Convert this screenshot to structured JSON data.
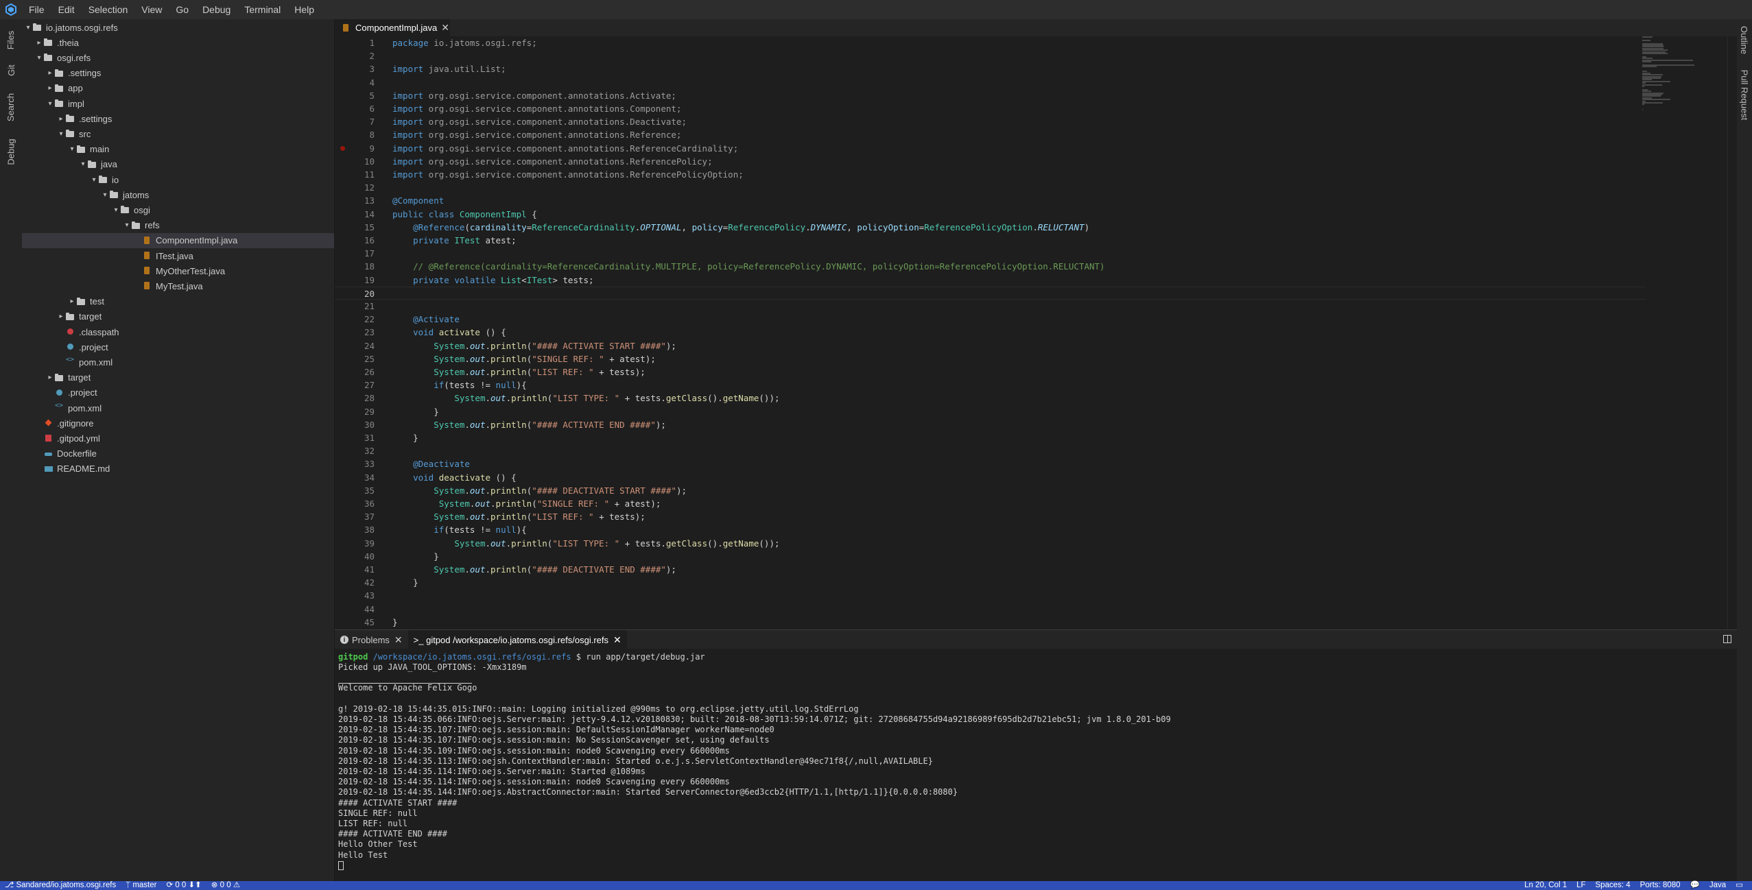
{
  "menubar": {
    "items": [
      "File",
      "Edit",
      "Selection",
      "View",
      "Go",
      "Debug",
      "Terminal",
      "Help"
    ]
  },
  "left_tabs": [
    "Files",
    "Git",
    "Search",
    "Debug"
  ],
  "right_tabs": [
    "Outline",
    "Pull Request"
  ],
  "explorer": {
    "items": [
      {
        "label": "io.jatoms.osgi.refs",
        "depth": 0,
        "kind": "folder",
        "open": true
      },
      {
        "label": ".theia",
        "depth": 1,
        "kind": "folder",
        "open": false
      },
      {
        "label": "osgi.refs",
        "depth": 1,
        "kind": "folder",
        "open": true
      },
      {
        "label": ".settings",
        "depth": 2,
        "kind": "folder",
        "open": false
      },
      {
        "label": "app",
        "depth": 2,
        "kind": "folder",
        "open": false
      },
      {
        "label": "impl",
        "depth": 2,
        "kind": "folder",
        "open": true
      },
      {
        "label": ".settings",
        "depth": 3,
        "kind": "folder",
        "open": false
      },
      {
        "label": "src",
        "depth": 3,
        "kind": "folder",
        "open": true
      },
      {
        "label": "main",
        "depth": 4,
        "kind": "folder",
        "open": true
      },
      {
        "label": "java",
        "depth": 5,
        "kind": "folder",
        "open": true
      },
      {
        "label": "io",
        "depth": 6,
        "kind": "folder",
        "open": true
      },
      {
        "label": "jatoms",
        "depth": 7,
        "kind": "folder",
        "open": true
      },
      {
        "label": "osgi",
        "depth": 8,
        "kind": "folder",
        "open": true
      },
      {
        "label": "refs",
        "depth": 9,
        "kind": "folder",
        "open": true
      },
      {
        "label": "ComponentImpl.java",
        "depth": 10,
        "kind": "jfile",
        "selected": true
      },
      {
        "label": "ITest.java",
        "depth": 10,
        "kind": "jfile"
      },
      {
        "label": "MyOtherTest.java",
        "depth": 10,
        "kind": "jfile"
      },
      {
        "label": "MyTest.java",
        "depth": 10,
        "kind": "jfile"
      },
      {
        "label": "test",
        "depth": 4,
        "kind": "folder",
        "open": false
      },
      {
        "label": "target",
        "depth": 3,
        "kind": "folder",
        "open": false
      },
      {
        "label": ".classpath",
        "depth": 3,
        "kind": "cp"
      },
      {
        "label": ".project",
        "depth": 3,
        "kind": "proj"
      },
      {
        "label": "pom.xml",
        "depth": 3,
        "kind": "xml"
      },
      {
        "label": "target",
        "depth": 2,
        "kind": "folder",
        "open": false
      },
      {
        "label": ".project",
        "depth": 2,
        "kind": "proj"
      },
      {
        "label": "pom.xml",
        "depth": 2,
        "kind": "xml"
      },
      {
        "label": ".gitignore",
        "depth": 1,
        "kind": "git"
      },
      {
        "label": ".gitpod.yml",
        "depth": 1,
        "kind": "yml"
      },
      {
        "label": "Dockerfile",
        "depth": 1,
        "kind": "docker"
      },
      {
        "label": "README.md",
        "depth": 1,
        "kind": "md"
      }
    ]
  },
  "editor": {
    "tab_label": "ComponentImpl.java",
    "current_line": 20,
    "breakpoint_line": 9,
    "lines": [
      [
        [
          "kw",
          "package"
        ],
        [
          "dim",
          " io.jatoms.osgi.refs;"
        ]
      ],
      [],
      [
        [
          "kw",
          "import"
        ],
        [
          "dim",
          " java.util.List;"
        ]
      ],
      [],
      [
        [
          "kw",
          "import"
        ],
        [
          "dim",
          " org.osgi.service.component.annotations.Activate;"
        ]
      ],
      [
        [
          "kw",
          "import"
        ],
        [
          "dim",
          " org.osgi.service.component.annotations.Component;"
        ]
      ],
      [
        [
          "kw",
          "import"
        ],
        [
          "dim",
          " org.osgi.service.component.annotations.Deactivate;"
        ]
      ],
      [
        [
          "kw",
          "import"
        ],
        [
          "dim",
          " org.osgi.service.component.annotations.Reference;"
        ]
      ],
      [
        [
          "kw",
          "import"
        ],
        [
          "dim",
          " org.osgi.service.component.annotations.ReferenceCardinality;"
        ]
      ],
      [
        [
          "kw",
          "import"
        ],
        [
          "dim",
          " org.osgi.service.component.annotations.ReferencePolicy;"
        ]
      ],
      [
        [
          "kw",
          "import"
        ],
        [
          "dim",
          " org.osgi.service.component.annotations.ReferencePolicyOption;"
        ]
      ],
      [],
      [
        [
          "kw",
          "@Component"
        ]
      ],
      [
        [
          "kw",
          "public"
        ],
        [
          "t",
          " "
        ],
        [
          "kw",
          "class"
        ],
        [
          "t",
          " "
        ],
        [
          "ty",
          "ComponentImpl"
        ],
        [
          "t",
          " {"
        ]
      ],
      [
        [
          "t",
          "    "
        ],
        [
          "kw",
          "@Reference"
        ],
        [
          "t",
          "("
        ],
        [
          "fi",
          "cardinality"
        ],
        [
          "t",
          "="
        ],
        [
          "ty",
          "ReferenceCardinality"
        ],
        [
          "t",
          "."
        ],
        [
          "fo",
          "OPTIONAL"
        ],
        [
          "t",
          ", "
        ],
        [
          "fi",
          "policy"
        ],
        [
          "t",
          "="
        ],
        [
          "ty",
          "ReferencePolicy"
        ],
        [
          "t",
          "."
        ],
        [
          "fo",
          "DYNAMIC"
        ],
        [
          "t",
          ", "
        ],
        [
          "fi",
          "policyOption"
        ],
        [
          "t",
          "="
        ],
        [
          "ty",
          "ReferencePolicyOption"
        ],
        [
          "t",
          "."
        ],
        [
          "fo",
          "RELUCTANT"
        ],
        [
          "t",
          ")"
        ]
      ],
      [
        [
          "t",
          "    "
        ],
        [
          "kw",
          "private"
        ],
        [
          "t",
          " "
        ],
        [
          "ty",
          "ITest"
        ],
        [
          "t",
          " atest;"
        ]
      ],
      [],
      [
        [
          "t",
          "    "
        ],
        [
          "cm",
          "// @Reference(cardinality=ReferenceCardinality.MULTIPLE, policy=ReferencePolicy.DYNAMIC, policyOption=ReferencePolicyOption.RELUCTANT)"
        ]
      ],
      [
        [
          "t",
          "    "
        ],
        [
          "kw",
          "private"
        ],
        [
          "t",
          " "
        ],
        [
          "kw",
          "volatile"
        ],
        [
          "t",
          " "
        ],
        [
          "ty",
          "List"
        ],
        [
          "t",
          "<"
        ],
        [
          "ty",
          "ITest"
        ],
        [
          "t",
          "> tests;"
        ]
      ],
      [],
      [],
      [
        [
          "t",
          "    "
        ],
        [
          "kw",
          "@Activate"
        ]
      ],
      [
        [
          "t",
          "    "
        ],
        [
          "kw",
          "void"
        ],
        [
          "t",
          " "
        ],
        [
          "an",
          "activate"
        ],
        [
          "t",
          " () {"
        ]
      ],
      [
        [
          "t",
          "        "
        ],
        [
          "ty",
          "System"
        ],
        [
          "t",
          "."
        ],
        [
          "fo",
          "out"
        ],
        [
          "t",
          "."
        ],
        [
          "an",
          "println"
        ],
        [
          "t",
          "("
        ],
        [
          "st",
          "\"#### ACTIVATE START ####\""
        ],
        [
          "t",
          ");"
        ]
      ],
      [
        [
          "t",
          "        "
        ],
        [
          "ty",
          "System"
        ],
        [
          "t",
          "."
        ],
        [
          "fo",
          "out"
        ],
        [
          "t",
          "."
        ],
        [
          "an",
          "println"
        ],
        [
          "t",
          "("
        ],
        [
          "st",
          "\"SINGLE REF: \""
        ],
        [
          "t",
          " + atest);"
        ]
      ],
      [
        [
          "t",
          "        "
        ],
        [
          "ty",
          "System"
        ],
        [
          "t",
          "."
        ],
        [
          "fo",
          "out"
        ],
        [
          "t",
          "."
        ],
        [
          "an",
          "println"
        ],
        [
          "t",
          "("
        ],
        [
          "st",
          "\"LIST REF: \""
        ],
        [
          "t",
          " + tests);"
        ]
      ],
      [
        [
          "t",
          "        "
        ],
        [
          "kw",
          "if"
        ],
        [
          "t",
          "(tests != "
        ],
        [
          "kw",
          "null"
        ],
        [
          "t",
          "){"
        ]
      ],
      [
        [
          "t",
          "            "
        ],
        [
          "ty",
          "System"
        ],
        [
          "t",
          "."
        ],
        [
          "fo",
          "out"
        ],
        [
          "t",
          "."
        ],
        [
          "an",
          "println"
        ],
        [
          "t",
          "("
        ],
        [
          "st",
          "\"LIST TYPE: \""
        ],
        [
          "t",
          " + tests."
        ],
        [
          "an",
          "getClass"
        ],
        [
          "t",
          "()."
        ],
        [
          "an",
          "getName"
        ],
        [
          "t",
          "());"
        ]
      ],
      [
        [
          "t",
          "        }"
        ]
      ],
      [
        [
          "t",
          "        "
        ],
        [
          "ty",
          "System"
        ],
        [
          "t",
          "."
        ],
        [
          "fo",
          "out"
        ],
        [
          "t",
          "."
        ],
        [
          "an",
          "println"
        ],
        [
          "t",
          "("
        ],
        [
          "st",
          "\"#### ACTIVATE END ####\""
        ],
        [
          "t",
          ");"
        ]
      ],
      [
        [
          "t",
          "    }"
        ]
      ],
      [],
      [
        [
          "t",
          "    "
        ],
        [
          "kw",
          "@Deactivate"
        ]
      ],
      [
        [
          "t",
          "    "
        ],
        [
          "kw",
          "void"
        ],
        [
          "t",
          " "
        ],
        [
          "an",
          "deactivate"
        ],
        [
          "t",
          " () {"
        ]
      ],
      [
        [
          "t",
          "        "
        ],
        [
          "ty",
          "System"
        ],
        [
          "t",
          "."
        ],
        [
          "fo",
          "out"
        ],
        [
          "t",
          "."
        ],
        [
          "an",
          "println"
        ],
        [
          "t",
          "("
        ],
        [
          "st",
          "\"#### DEACTIVATE START ####\""
        ],
        [
          "t",
          ");"
        ]
      ],
      [
        [
          "t",
          "         "
        ],
        [
          "ty",
          "System"
        ],
        [
          "t",
          "."
        ],
        [
          "fo",
          "out"
        ],
        [
          "t",
          "."
        ],
        [
          "an",
          "println"
        ],
        [
          "t",
          "("
        ],
        [
          "st",
          "\"SINGLE REF: \""
        ],
        [
          "t",
          " + atest);"
        ]
      ],
      [
        [
          "t",
          "        "
        ],
        [
          "ty",
          "System"
        ],
        [
          "t",
          "."
        ],
        [
          "fo",
          "out"
        ],
        [
          "t",
          "."
        ],
        [
          "an",
          "println"
        ],
        [
          "t",
          "("
        ],
        [
          "st",
          "\"LIST REF: \""
        ],
        [
          "t",
          " + tests);"
        ]
      ],
      [
        [
          "t",
          "        "
        ],
        [
          "kw",
          "if"
        ],
        [
          "t",
          "(tests != "
        ],
        [
          "kw",
          "null"
        ],
        [
          "t",
          "){"
        ]
      ],
      [
        [
          "t",
          "            "
        ],
        [
          "ty",
          "System"
        ],
        [
          "t",
          "."
        ],
        [
          "fo",
          "out"
        ],
        [
          "t",
          "."
        ],
        [
          "an",
          "println"
        ],
        [
          "t",
          "("
        ],
        [
          "st",
          "\"LIST TYPE: \""
        ],
        [
          "t",
          " + tests."
        ],
        [
          "an",
          "getClass"
        ],
        [
          "t",
          "()."
        ],
        [
          "an",
          "getName"
        ],
        [
          "t",
          "());"
        ]
      ],
      [
        [
          "t",
          "        }"
        ]
      ],
      [
        [
          "t",
          "        "
        ],
        [
          "ty",
          "System"
        ],
        [
          "t",
          "."
        ],
        [
          "fo",
          "out"
        ],
        [
          "t",
          "."
        ],
        [
          "an",
          "println"
        ],
        [
          "t",
          "("
        ],
        [
          "st",
          "\"#### DEACTIVATE END ####\""
        ],
        [
          "t",
          ");"
        ]
      ],
      [
        [
          "t",
          "    }"
        ]
      ],
      [],
      [],
      [
        [
          "t",
          "}"
        ]
      ],
      []
    ]
  },
  "panel": {
    "tabs": [
      "Problems",
      ">_ gitpod /workspace/io.jatoms.osgi.refs/osgi.refs"
    ],
    "prompt_user": "gitpod",
    "prompt_path": "/workspace/io.jatoms.osgi.refs/osgi.refs",
    "prompt_cmd": " $ run app/target/debug.jar",
    "lines": [
      "Picked up JAVA_TOOL_OPTIONS: -Xmx3189m",
      "",
      "Welcome to Apache Felix Gogo",
      "",
      "g! 2019-02-18 15:44:35.015:INFO::main: Logging initialized @990ms to org.eclipse.jetty.util.log.StdErrLog",
      "2019-02-18 15:44:35.066:INFO:oejs.Server:main: jetty-9.4.12.v20180830; built: 2018-08-30T13:59:14.071Z; git: 27208684755d94a92186989f695db2d7b21ebc51; jvm 1.8.0_201-b09",
      "2019-02-18 15:44:35.107:INFO:oejs.session:main: DefaultSessionIdManager workerName=node0",
      "2019-02-18 15:44:35.107:INFO:oejs.session:main: No SessionScavenger set, using defaults",
      "2019-02-18 15:44:35.109:INFO:oejs.session:main: node0 Scavenging every 660000ms",
      "2019-02-18 15:44:35.113:INFO:oejsh.ContextHandler:main: Started o.e.j.s.ServletContextHandler@49ec71f8{/,null,AVAILABLE}",
      "2019-02-18 15:44:35.114:INFO:oejs.Server:main: Started @1089ms",
      "2019-02-18 15:44:35.114:INFO:oejs.session:main: node0 Scavenging every 660000ms",
      "2019-02-18 15:44:35.144:INFO:oejs.AbstractConnector:main: Started ServerConnector@6ed3ccb2{HTTP/1.1,[http/1.1]}{0.0.0.0:8080}",
      "#### ACTIVATE START ####",
      "SINGLE REF: null",
      "LIST REF: null",
      "#### ACTIVATE END ####",
      "Hello Other Test",
      "Hello Test"
    ]
  },
  "statusbar": {
    "repo": "Sandared/io.jatoms.osgi.refs",
    "branch": "master",
    "sync": "0 0",
    "problems": "0 0",
    "position": "Ln 20, Col 1",
    "eol": "LF",
    "spaces": "Spaces: 4",
    "ports": "Ports: 8080",
    "language": "Java"
  },
  "colors": {
    "statusbar": "#2f4fb6",
    "selection": "#37373d",
    "keyword": "#569cd6",
    "type": "#4ec9b0",
    "string": "#ce9178",
    "comment": "#6a9955"
  }
}
